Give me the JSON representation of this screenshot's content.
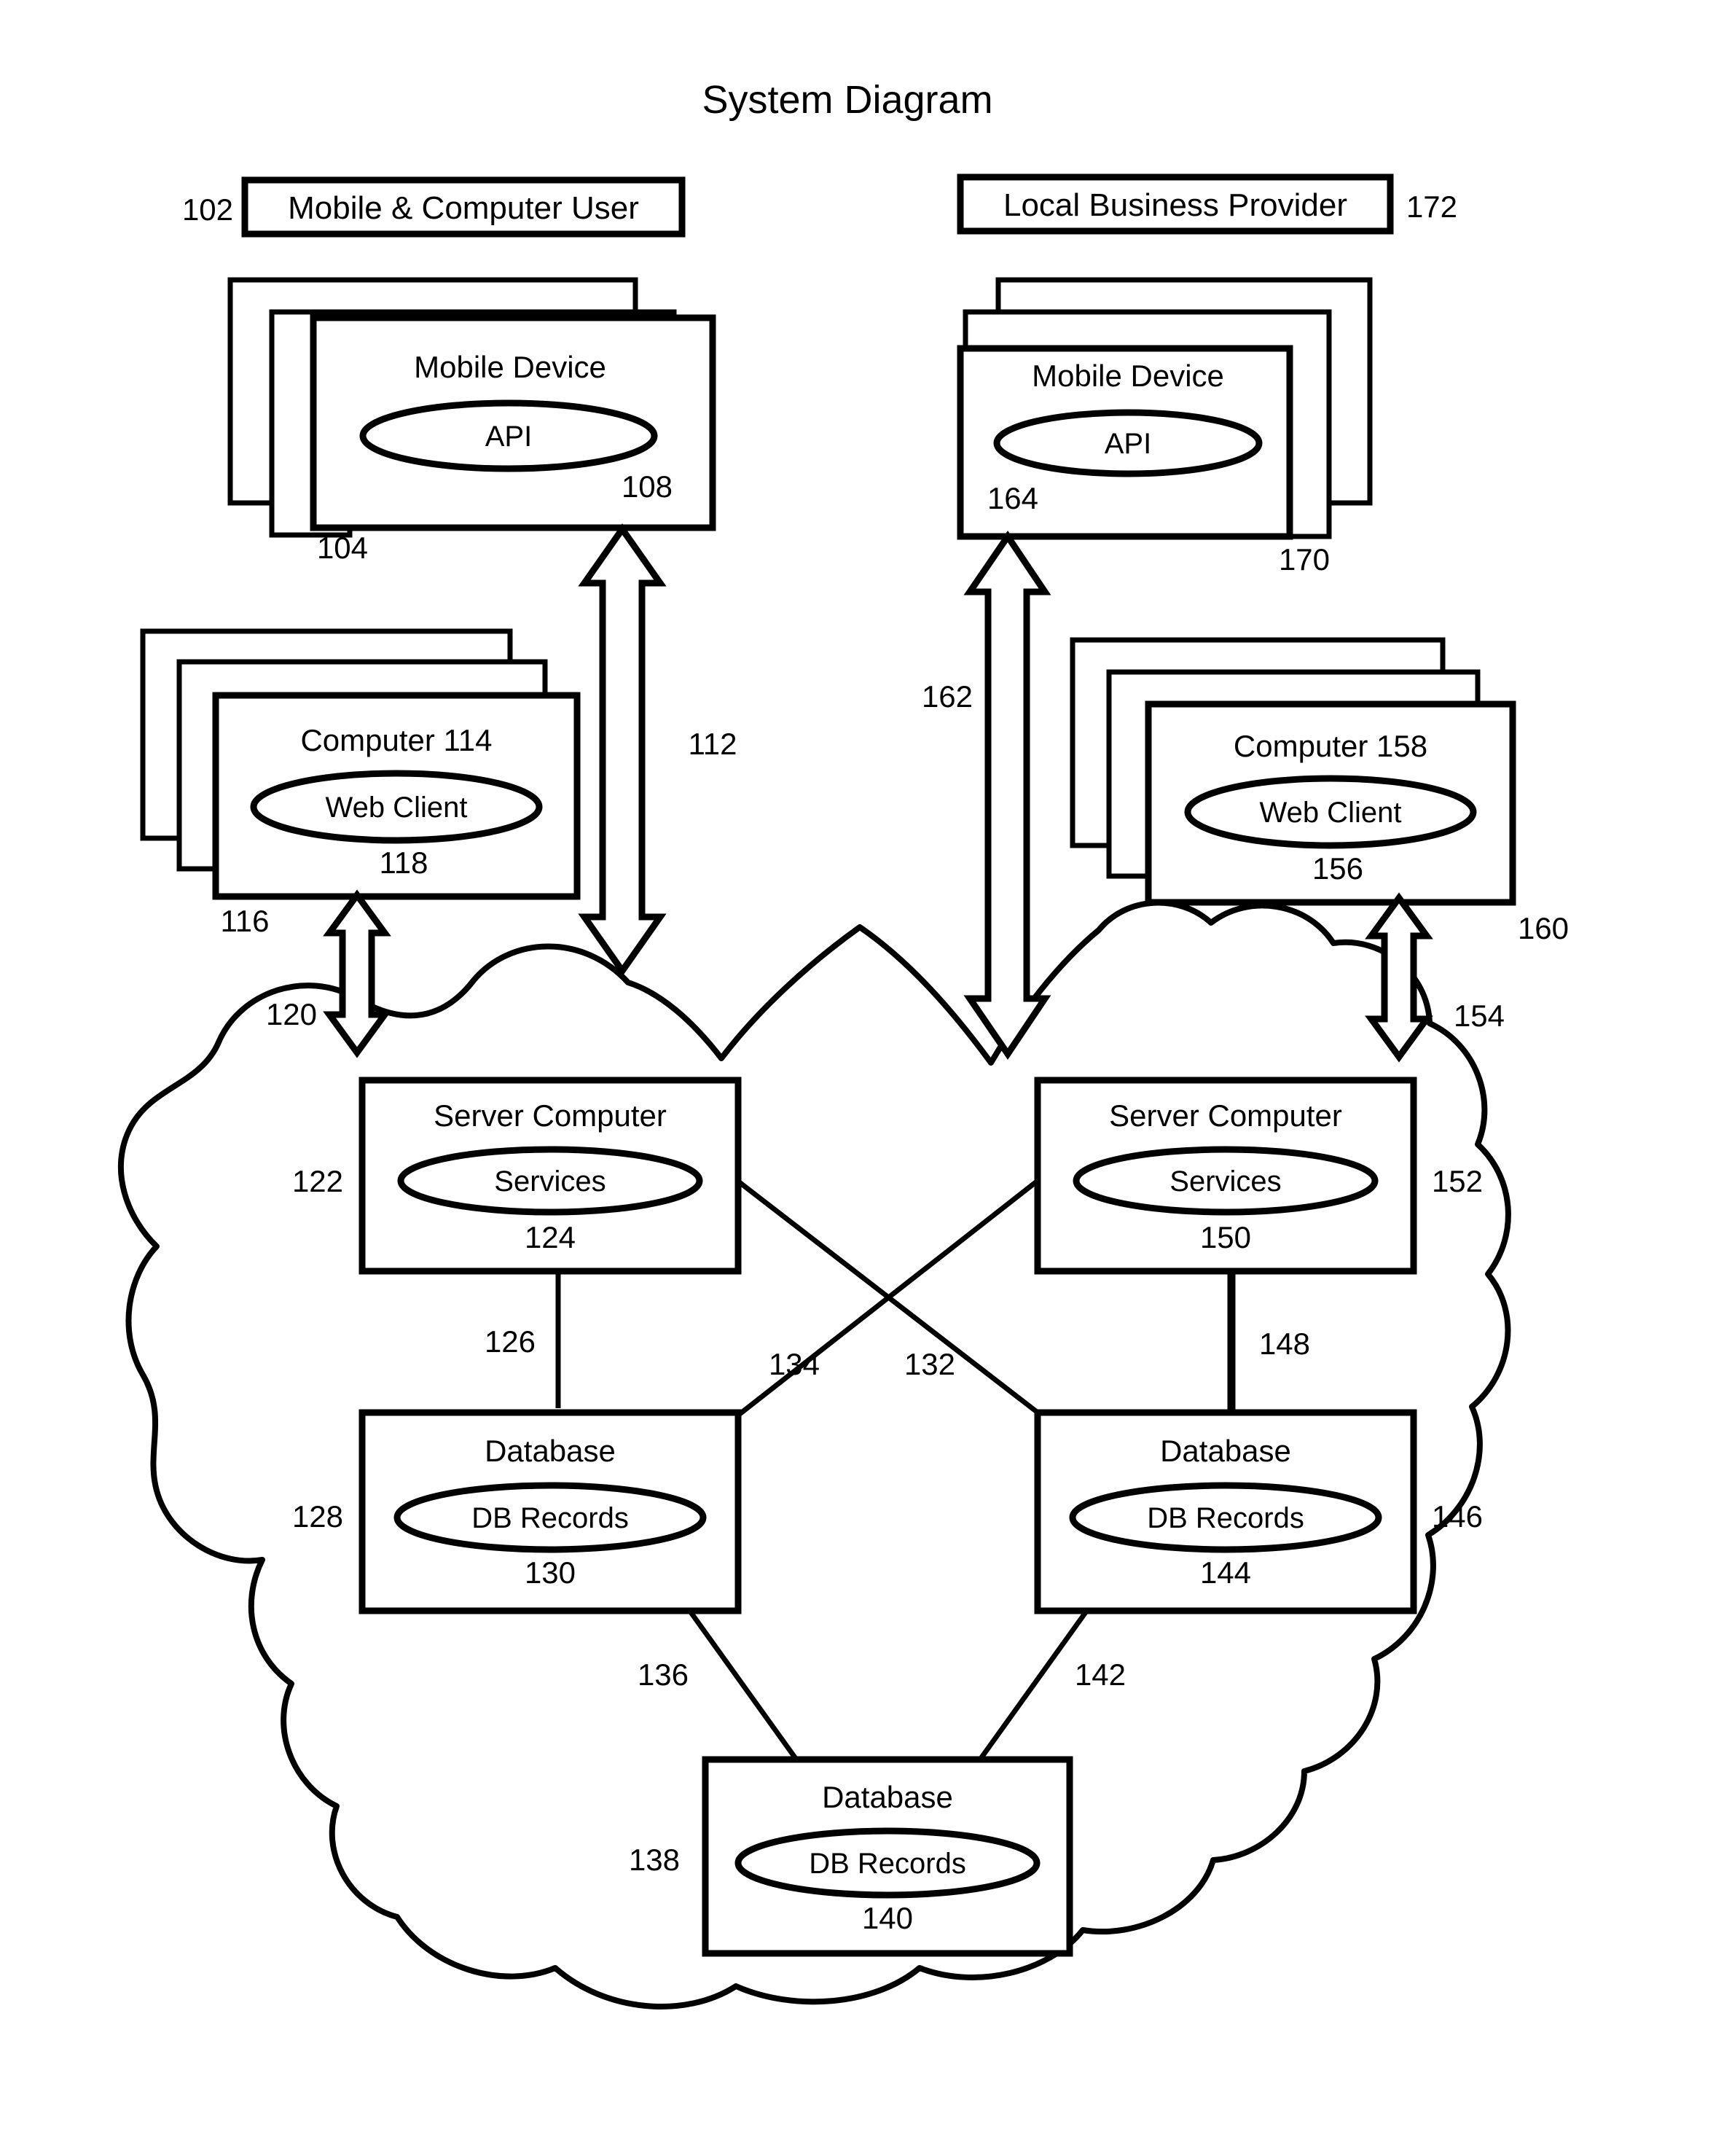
{
  "figure": {
    "title": "System Diagram",
    "kind": "patent-system-diagram"
  },
  "actors": {
    "left": {
      "label": "Mobile & Computer User",
      "ref": "102"
    },
    "right": {
      "label": "Local Business Provider",
      "ref": "172"
    }
  },
  "nodes": {
    "left_mobile": {
      "title": "Mobile Device",
      "inner": "API",
      "ref_stack": "104",
      "ref_inner": "108"
    },
    "right_mobile": {
      "title": "Mobile Device",
      "inner": "API",
      "ref_stack": "170",
      "ref_inner": "164"
    },
    "left_computer": {
      "title": "Computer 114",
      "inner": "Web Client",
      "ref_stack": "116",
      "ref_inner": "118"
    },
    "right_computer": {
      "title": "Computer 158",
      "inner": "Web Client",
      "ref_stack": "160",
      "ref_inner": "156"
    },
    "left_server": {
      "title": "Server Computer",
      "inner": "Services",
      "ref_box": "122",
      "ref_inner": "124"
    },
    "right_server": {
      "title": "Server Computer",
      "inner": "Services",
      "ref_box": "152",
      "ref_inner": "150"
    },
    "left_database": {
      "title": "Database",
      "inner": "DB Records",
      "ref_box": "128",
      "ref_inner": "130"
    },
    "right_database": {
      "title": "Database",
      "inner": "DB Records",
      "ref_box": "146",
      "ref_inner": "144"
    },
    "bottom_database": {
      "title": "Database",
      "inner": "DB Records",
      "ref_box": "138",
      "ref_inner": "140"
    }
  },
  "connectors": {
    "left_mobile_to_cloud": "112",
    "left_computer_to_cloud": "120",
    "right_mobile_to_cloud": "162",
    "right_computer_to_cloud": "154",
    "left_server_to_left_db": "126",
    "left_server_to_right_db": "134",
    "right_server_to_left_db": "132",
    "right_server_to_right_db": "148",
    "left_db_to_bottom_db": "136",
    "right_db_to_bottom_db": "142"
  },
  "colors": {
    "ink": "#000000",
    "paper": "#ffffff"
  }
}
